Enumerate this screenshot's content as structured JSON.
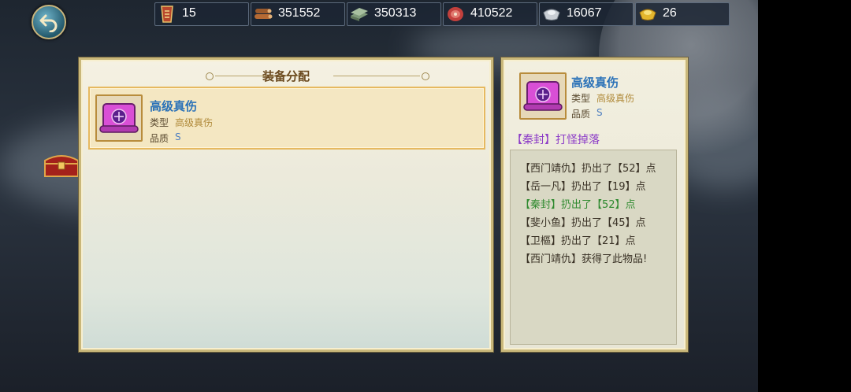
{
  "resources": [
    {
      "icon": "rank-badge-icon",
      "value": "15"
    },
    {
      "icon": "wood-icon",
      "value": "351552"
    },
    {
      "icon": "stone-icon",
      "value": "350313"
    },
    {
      "icon": "meat-icon",
      "value": "410522"
    },
    {
      "icon": "silver-icon",
      "value": "16067"
    },
    {
      "icon": "gold-ingot-icon",
      "value": "26"
    }
  ],
  "left_panel": {
    "title": "装备分配",
    "item": {
      "name": "高级真伤",
      "type_label": "类型",
      "type_value": "高级真伤",
      "quality_label": "品质",
      "quality_value": "S"
    }
  },
  "right_panel": {
    "item": {
      "name": "高级真伤",
      "type_label": "类型",
      "type_value": "高级真伤",
      "quality_label": "品质",
      "quality_value": "S"
    },
    "drop_text": "【秦封】打怪掉落",
    "log": [
      {
        "text": "【西门靖仇】扔出了【52】点",
        "highlight": false
      },
      {
        "text": "【岳一凡】扔出了【19】点",
        "highlight": false
      },
      {
        "text": "【秦封】扔出了【52】点",
        "highlight": true
      },
      {
        "text": "【斐小鱼】扔出了【45】点",
        "highlight": false
      },
      {
        "text": "【卫樞】扔出了【21】点",
        "highlight": false
      },
      {
        "text": "【西门靖仇】获得了此物品!",
        "highlight": false
      }
    ]
  },
  "colors": {
    "item_name": "#2b72b8",
    "drop_text": "#8c3cc7",
    "highlight_log": "#2f8a2f"
  }
}
